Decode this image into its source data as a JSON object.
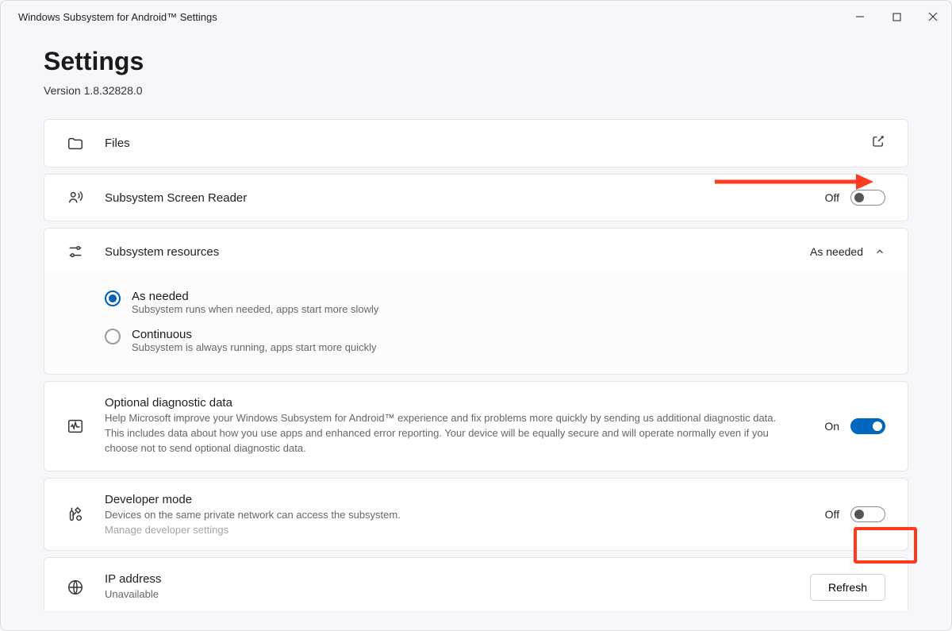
{
  "window": {
    "title": "Windows Subsystem for Android™ Settings"
  },
  "header": {
    "title": "Settings",
    "version": "Version 1.8.32828.0"
  },
  "rows": {
    "files": {
      "label": "Files"
    },
    "reader": {
      "label": "Subsystem Screen Reader",
      "state": "Off"
    },
    "resources": {
      "label": "Subsystem resources",
      "value": "As needed",
      "options": [
        {
          "title": "As needed",
          "desc": "Subsystem runs when needed, apps start more slowly",
          "checked": true
        },
        {
          "title": "Continuous",
          "desc": "Subsystem is always running, apps start more quickly",
          "checked": false
        }
      ]
    },
    "diag": {
      "label": "Optional diagnostic data",
      "desc": "Help Microsoft improve your Windows Subsystem for Android™ experience and fix problems more quickly by sending us additional diagnostic data. This includes data about how you use apps and enhanced error reporting. Your device will be equally secure and will operate normally even if you choose not to send optional diagnostic data.",
      "state": "On"
    },
    "dev": {
      "label": "Developer mode",
      "desc": "Devices on the same private network can access the subsystem.",
      "sublink": "Manage developer settings",
      "state": "Off"
    },
    "ip": {
      "label": "IP address",
      "status": "Unavailable",
      "button": "Refresh"
    }
  }
}
